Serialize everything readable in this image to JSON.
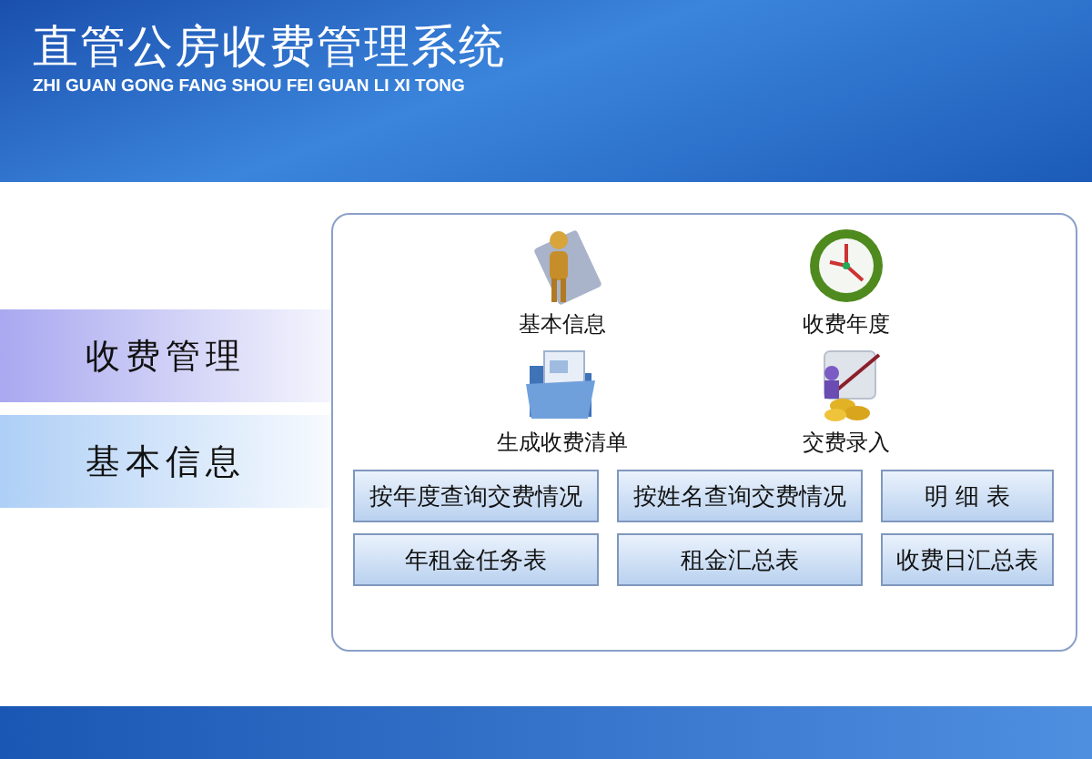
{
  "header": {
    "title": "直管公房收费管理系统",
    "subtitle": "ZHI GUAN GONG FANG SHOU FEI GUAN LI XI TONG"
  },
  "sidebar": {
    "items": [
      {
        "label": "收费管理",
        "selected": true
      },
      {
        "label": "基本信息",
        "selected": false
      }
    ]
  },
  "shortcuts": [
    {
      "kind": "person",
      "label": "基本信息"
    },
    {
      "kind": "clock",
      "label": "收费年度"
    },
    {
      "kind": "folder",
      "label": "生成收费清单"
    },
    {
      "kind": "coins",
      "label": "交费录入"
    }
  ],
  "buttons": [
    [
      "按年度查询交费情况",
      "按姓名查询交费情况",
      "明 细 表"
    ],
    [
      "年租金任务表",
      "租金汇总表",
      "收费日汇总表"
    ]
  ]
}
